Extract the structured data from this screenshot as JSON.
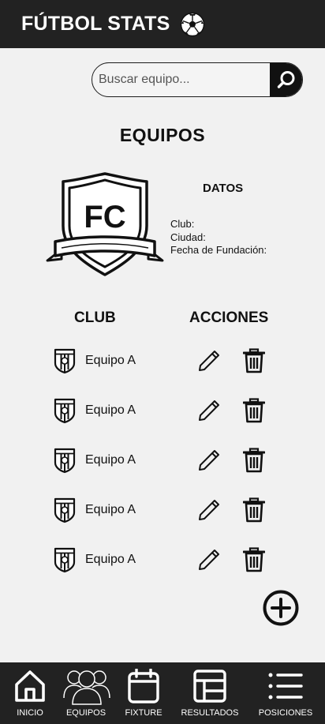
{
  "header": {
    "title": "FÚTBOL STATS",
    "icon": "soccer-ball-icon"
  },
  "search": {
    "placeholder": "Buscar equipo...",
    "icon": "search-icon"
  },
  "page_title": "EQUIPOS",
  "datos": {
    "title": "DATOS",
    "club_label": "Club:",
    "ciudad_label": "Ciudad:",
    "fundacion_label": "Fecha de Fundación:"
  },
  "crest": {
    "text": "FC"
  },
  "table": {
    "headers": {
      "club": "CLUB",
      "acciones": "ACCIONES"
    },
    "rows": [
      {
        "name": "Equipo A"
      },
      {
        "name": "Equipo A"
      },
      {
        "name": "Equipo A"
      },
      {
        "name": "Equipo A"
      },
      {
        "name": "Equipo A"
      }
    ]
  },
  "nav": {
    "items": [
      {
        "label": "INICIO",
        "icon": "home-icon"
      },
      {
        "label": "EQUIPOS",
        "icon": "group-icon"
      },
      {
        "label": "FIXTURE",
        "icon": "calendar-icon"
      },
      {
        "label": "RESULTADOS",
        "icon": "grid-table-icon"
      },
      {
        "label": "POSICIONES",
        "icon": "list-icon"
      }
    ]
  },
  "colors": {
    "bar": "#222222",
    "background": "#f1f1f1",
    "ink": "#111111"
  }
}
